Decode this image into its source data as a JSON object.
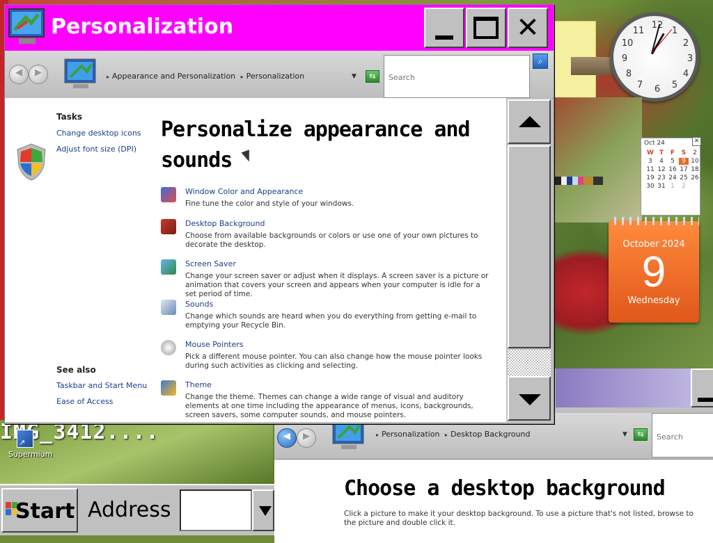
{
  "window": {
    "title": "Personalization",
    "title_color": "#ff00ff",
    "minimize_icon": "minimize-icon",
    "maximize_icon": "maximize-icon",
    "close_icon": "close-icon"
  },
  "address_bar": {
    "breadcrumbs": [
      "Appearance and Personalization",
      "Personalization"
    ],
    "search_placeholder": "Search"
  },
  "sidebar": {
    "tasks_heading": "Tasks",
    "tasks": [
      "Change desktop icons",
      "Adjust font size (DPI)"
    ],
    "see_also_heading": "See also",
    "see_also": [
      "Taskbar and Start Menu",
      "Ease of Access"
    ]
  },
  "main": {
    "title": "Personalize appearance and sounds",
    "items": [
      {
        "label": "Window Color and Appearance",
        "desc": "Fine tune the color and style of your windows.",
        "icon": "window-color-icon"
      },
      {
        "label": "Desktop Background",
        "desc": "Choose from available backgrounds or colors or use one of your own pictures to decorate the desktop.",
        "icon": "desktop-background-icon"
      },
      {
        "label": "Screen Saver",
        "desc": "Change your screen saver or adjust when it displays. A screen saver is a picture or animation that covers your screen and appears when your computer is idle for a set period of time.",
        "icon": "screen-saver-icon"
      },
      {
        "label": "Sounds",
        "desc": "Change which sounds are heard when you do everything from getting e-mail to emptying your Recycle Bin.",
        "icon": "sounds-icon"
      },
      {
        "label": "Mouse Pointers",
        "desc": "Pick a different mouse pointer. You can also change how the mouse pointer looks during such activities as clicking and selecting.",
        "icon": "mouse-pointers-icon"
      },
      {
        "label": "Theme",
        "desc": "Change the theme. Themes can change a wide range of visual and auditory elements at one time including the appearance of menus, icons, backgrounds, screen savers, some computer sounds, and mouse pointers.",
        "icon": "theme-icon"
      }
    ]
  },
  "second_window": {
    "breadcrumbs": [
      "Personalization",
      "Desktop Background"
    ],
    "search_placeholder": "Search",
    "title": "Choose a desktop background",
    "desc": "Click a picture to make it your desktop background. To use a picture that's not listed, browse to the picture and double click it."
  },
  "desktop": {
    "filename": "IMG_3412....",
    "shortcut_label": "Supermium"
  },
  "clock": {
    "numbers": [
      "12",
      "1",
      "2",
      "3",
      "4",
      "5",
      "6",
      "7",
      "8",
      "9",
      "10",
      "11"
    ]
  },
  "mini_calendar": {
    "month_label": "Oct 24",
    "day_headers": [
      "W",
      "T",
      "F",
      "S"
    ],
    "rows": [
      [
        "2",
        "3",
        "4",
        "5"
      ],
      [
        "9",
        "10",
        "11",
        "12"
      ],
      [
        "16",
        "17",
        "18",
        "19"
      ],
      [
        "23",
        "24",
        "25",
        "26"
      ],
      [
        "30",
        "31",
        "1",
        "2"
      ]
    ],
    "today": "9"
  },
  "big_calendar": {
    "month": "October 2024",
    "day": "9",
    "weekday": "Wednesday",
    "color": "#e8641e"
  },
  "taskbar": {
    "start_label": "Start",
    "address_label": "Address"
  }
}
